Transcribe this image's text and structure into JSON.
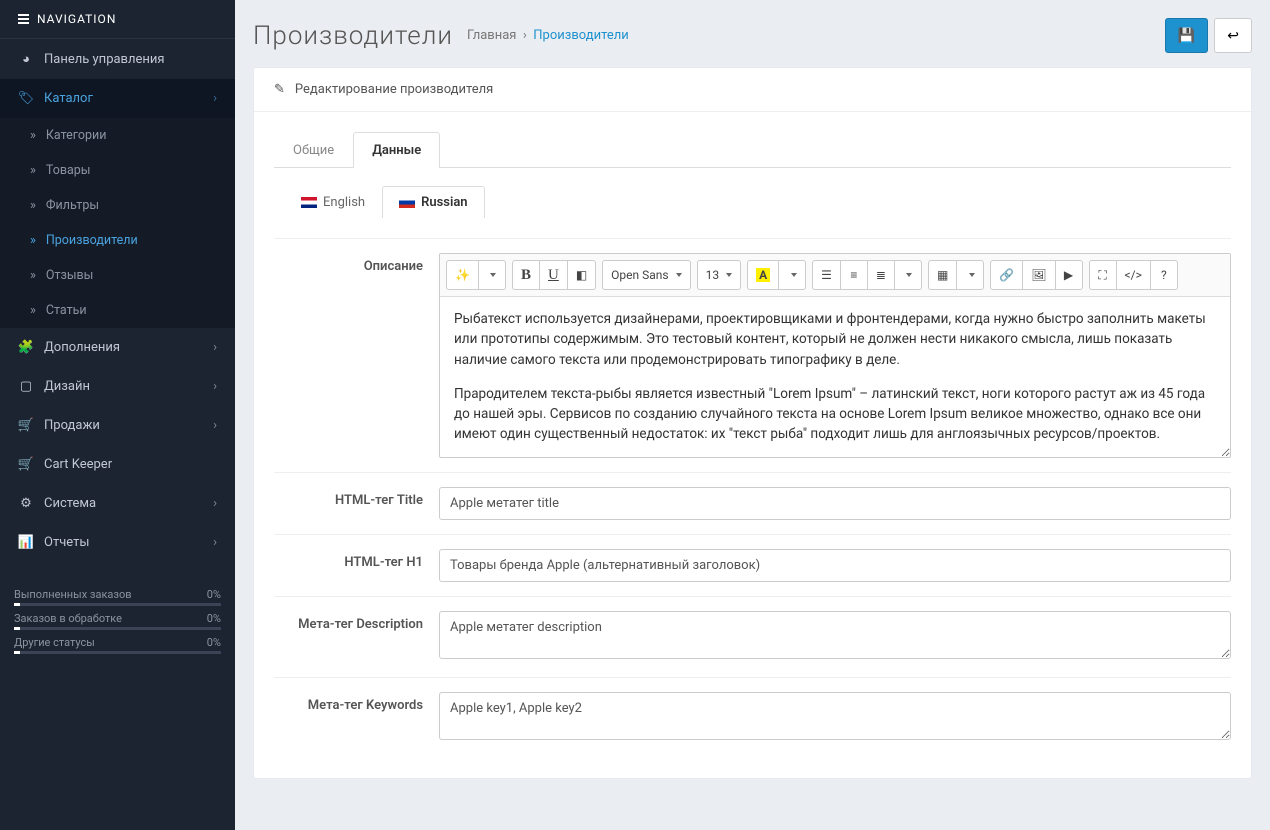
{
  "nav": {
    "header": "NAVIGATION",
    "items": [
      {
        "label": "Панель управления",
        "icon": "dashboard"
      },
      {
        "label": "Каталог",
        "icon": "tag",
        "active": true,
        "expanded": true,
        "children": [
          {
            "label": "Категории"
          },
          {
            "label": "Товары"
          },
          {
            "label": "Фильтры"
          },
          {
            "label": "Производители",
            "active": true
          },
          {
            "label": "Отзывы"
          },
          {
            "label": "Статьи"
          }
        ]
      },
      {
        "label": "Дополнения",
        "icon": "puzzle"
      },
      {
        "label": "Дизайн",
        "icon": "display"
      },
      {
        "label": "Продажи",
        "icon": "cart"
      },
      {
        "label": "Cart Keeper",
        "icon": "cart"
      },
      {
        "label": "Система",
        "icon": "gear"
      },
      {
        "label": "Отчеты",
        "icon": "bars"
      }
    ],
    "stats": [
      {
        "label": "Выполненных заказов",
        "value": "0%"
      },
      {
        "label": "Заказов в обработке",
        "value": "0%"
      },
      {
        "label": "Другие статусы",
        "value": "0%"
      }
    ]
  },
  "page": {
    "title": "Производители",
    "breadcrumb_home": "Главная",
    "breadcrumb_current": "Производители",
    "panel_title": "Редактирование производителя"
  },
  "tabs": [
    {
      "label": "Общие"
    },
    {
      "label": "Данные",
      "active": true
    }
  ],
  "lang_tabs": [
    {
      "label": "English",
      "flag": "en"
    },
    {
      "label": "Russian",
      "flag": "ru",
      "active": true
    }
  ],
  "editor": {
    "font_family": "Open Sans",
    "font_size": "13",
    "paragraphs": [
      "Рыбатекст используется дизайнерами, проектировщиками и фронтендерами, когда нужно быстро заполнить макеты или прототипы содержимым. Это тестовый контент, который не должен нести никакого смысла, лишь показать наличие самого текста или продемонстрировать типографику в деле.",
      "Прародителем текста-рыбы является известный \"Lorem Ipsum\" – латинский текст, ноги которого растут аж из 45 года до нашей эры. Сервисов по созданию случайного текста на основе Lorem Ipsum великое множество, однако все они имеют один существенный недостаток: их \"текст рыба\" подходит лишь для англоязычных ресурсов/проектов."
    ]
  },
  "fields": {
    "description_label": "Описание",
    "title_label": "HTML-тег Title",
    "title_value": "Apple метатег title",
    "h1_label": "HTML-тег H1",
    "h1_value": "Товары бренда Apple (альтернативный заголовок)",
    "meta_desc_label": "Мета-тег Description",
    "meta_desc_value": "Apple метатег description",
    "meta_keys_label": "Мета-тег Keywords",
    "meta_keys_value": "Apple key1, Apple key2"
  }
}
